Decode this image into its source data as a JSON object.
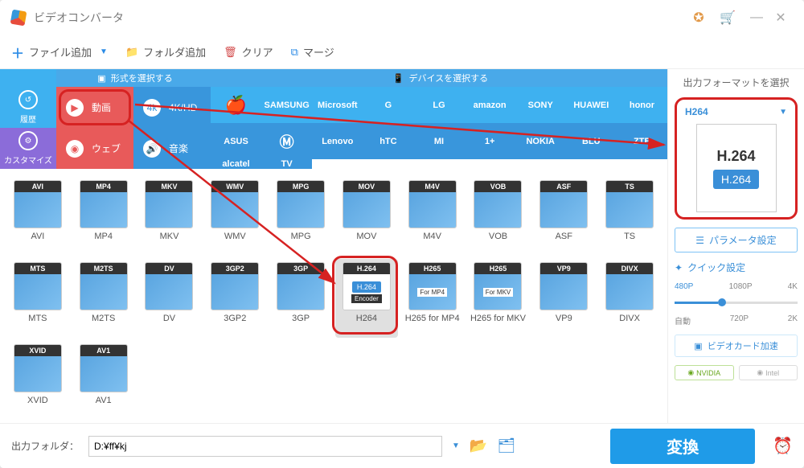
{
  "app_title": "ビデオコンバータ",
  "toolbar": {
    "add_file": "ファイル追加",
    "add_folder": "フォルダ追加",
    "clear": "クリア",
    "merge": "マージ"
  },
  "top_tabs": {
    "format": "形式を選択する",
    "device": "デバイスを選択する"
  },
  "left": {
    "history": "履歴",
    "customize": "カスタマイズ"
  },
  "categories": {
    "video": "動画",
    "hd": "4K/HD",
    "web": "ウェブ",
    "audio": "音楽"
  },
  "brands": [
    "",
    "SAMSUNG",
    "Microsoft",
    "G",
    "LG",
    "amazon",
    "SONY",
    "HUAWEI",
    "honor",
    "ASUS",
    "",
    "Lenovo",
    "hTC",
    "MI",
    "1+",
    "NOKIA",
    "BLU",
    "ZTE",
    "alcatel",
    "TV"
  ],
  "formats": [
    {
      "tag": "AVI",
      "label": "AVI"
    },
    {
      "tag": "MP4",
      "label": "MP4"
    },
    {
      "tag": "MKV",
      "label": "MKV"
    },
    {
      "tag": "WMV",
      "label": "WMV"
    },
    {
      "tag": "MPG",
      "label": "MPG"
    },
    {
      "tag": "MOV",
      "label": "MOV"
    },
    {
      "tag": "M4V",
      "label": "M4V"
    },
    {
      "tag": "VOB",
      "label": "VOB"
    },
    {
      "tag": "ASF",
      "label": "ASF"
    },
    {
      "tag": "TS",
      "label": "TS"
    },
    {
      "tag": "MTS",
      "label": "MTS"
    },
    {
      "tag": "M2TS",
      "label": "M2TS"
    },
    {
      "tag": "DV",
      "label": "DV"
    },
    {
      "tag": "3GP2",
      "label": "3GP2"
    },
    {
      "tag": "3GP",
      "label": "3GP"
    },
    {
      "tag": "H.264",
      "label": "H264",
      "h264": true,
      "selected": true
    },
    {
      "tag": "H265",
      "label": "H265 for MP4",
      "sub": "For MP4"
    },
    {
      "tag": "H265",
      "label": "H265 for MKV",
      "sub": "For MKV"
    },
    {
      "tag": "VP9",
      "label": "VP9"
    },
    {
      "tag": "DIVX",
      "label": "DIVX"
    },
    {
      "tag": "XVID",
      "label": "XVID"
    },
    {
      "tag": "AV1",
      "label": "AV1"
    }
  ],
  "right": {
    "title": "出力フォーマットを選択",
    "selected": "H264",
    "thumb_top": "H.264",
    "thumb_bot": "H.264",
    "param": "パラメータ設定",
    "quick": "クイック設定",
    "reso_top": [
      "480P",
      "1080P",
      "4K"
    ],
    "reso_bot": [
      "自動",
      "720P",
      "2K"
    ],
    "gpu": "ビデオカード加速",
    "nvidia": "NVIDIA",
    "intel": "Intel"
  },
  "bottom": {
    "label": "出力フォルダ：",
    "path": "D:¥ff¥kj",
    "convert": "変換"
  }
}
